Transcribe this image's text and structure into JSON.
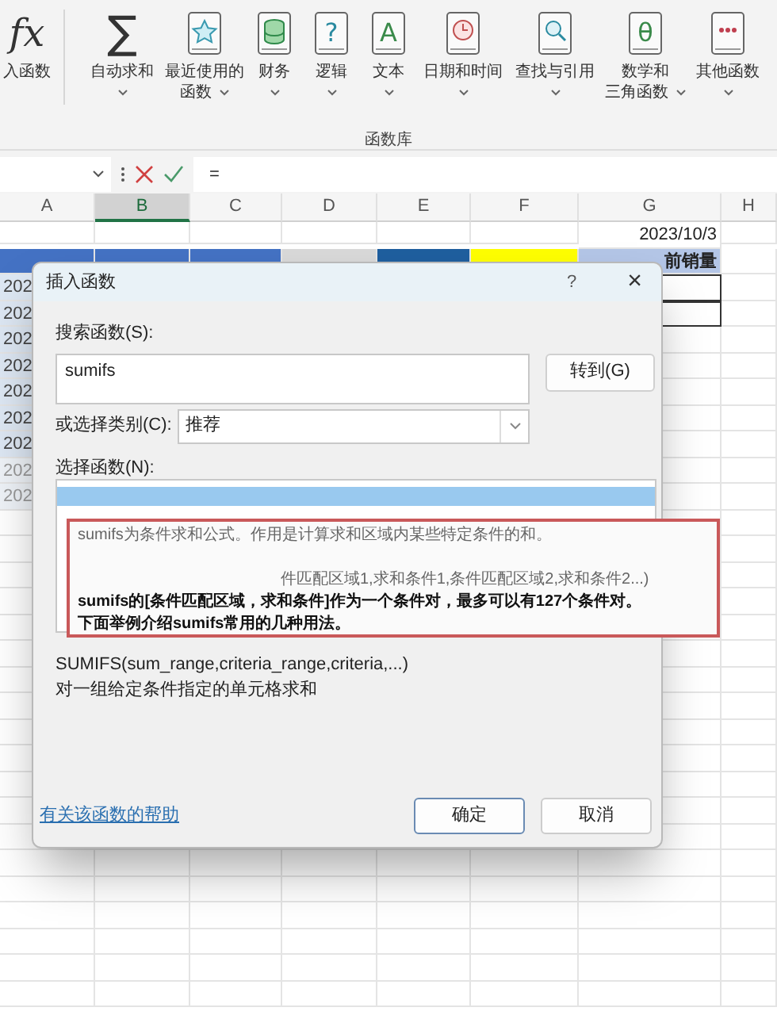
{
  "ribbon": {
    "items": [
      {
        "label_lines": [
          "入函数"
        ],
        "kind": "fx",
        "glyph": "fx",
        "dropdown": false
      },
      {
        "label_lines": [
          "自动求和"
        ],
        "kind": "sigma",
        "glyph": "∑",
        "dropdown": true
      },
      {
        "label_lines": [
          "最近使用的",
          "函数"
        ],
        "kind": "star",
        "dropdown": true
      },
      {
        "label_lines": [
          "财务"
        ],
        "kind": "stack",
        "dropdown": true
      },
      {
        "label_lines": [
          "逻辑"
        ],
        "kind": "letter",
        "glyph": "?",
        "dropdown": true
      },
      {
        "label_lines": [
          "文本"
        ],
        "kind": "letter",
        "glyph": "A",
        "dropdown": true
      },
      {
        "label_lines": [
          "日期和时间"
        ],
        "kind": "clock",
        "dropdown": true
      },
      {
        "label_lines": [
          "查找与引用"
        ],
        "kind": "magnifier",
        "dropdown": true
      },
      {
        "label_lines": [
          "数学和",
          "三角函数"
        ],
        "kind": "letter",
        "glyph": "θ",
        "dropdown": true
      },
      {
        "label_lines": [
          "其他函数"
        ],
        "kind": "dots",
        "dropdown": true
      }
    ],
    "group_label": "函数库"
  },
  "formula_bar": {
    "formula": "="
  },
  "sheet": {
    "columns": [
      {
        "label": "A",
        "selected": false
      },
      {
        "label": "B",
        "selected": true
      },
      {
        "label": "C",
        "selected": false
      },
      {
        "label": "D",
        "selected": false
      },
      {
        "label": "E",
        "selected": false
      },
      {
        "label": "F",
        "selected": false
      },
      {
        "label": "G",
        "selected": false
      },
      {
        "label": "H",
        "selected": false
      }
    ],
    "date_cell": "2023/10/3",
    "header_cells": [
      {
        "color": "#4472c4"
      },
      {
        "color": "#4472c4"
      },
      {
        "color": "#4472c4"
      },
      {
        "color": "#d9d9d9"
      },
      {
        "color": "#1f5f9f"
      },
      {
        "color": "#ffff00"
      },
      {
        "color": "#b4c6e7",
        "text": "前销量"
      }
    ],
    "row_stubs": [
      "202",
      "202",
      "202",
      "202",
      "202",
      "202",
      "202",
      "202",
      "202"
    ]
  },
  "dialog": {
    "title": "插入函数",
    "help": "?",
    "close": "×",
    "search_label": "搜索函数(S):",
    "search_value": "sumifs",
    "go_button": "转到(G)",
    "category_label": "或选择类别(C):",
    "category_value": "推荐",
    "list_label": "选择函数(N):",
    "function_list": [
      {
        "selected": true
      }
    ],
    "annotation_lines": [
      {
        "text": "sumifs为条件求和公式。作用是计算求和区域内某些特定条件的和。",
        "bold": false,
        "kind": "full"
      },
      {
        "text": "件匹配区域1,求和条件1,条件匹配区域2,求和条件2...)",
        "bold": false,
        "kind": "partly_hidden"
      },
      {
        "text": "sumifs的[条件匹配区域，求和条件]作为一个条件对，最多可以有127个条件对。",
        "bold": true,
        "kind": "full"
      },
      {
        "text": "下面举例介绍sumifs常用的几种用法。",
        "bold": true,
        "kind": "full"
      }
    ],
    "syntax": "SUMIFS(sum_range,criteria_range,criteria,...)",
    "description": "对一组给定条件指定的单元格求和",
    "help_link": "有关该函数的帮助",
    "ok_button": "确定",
    "cancel_button": "取消"
  }
}
